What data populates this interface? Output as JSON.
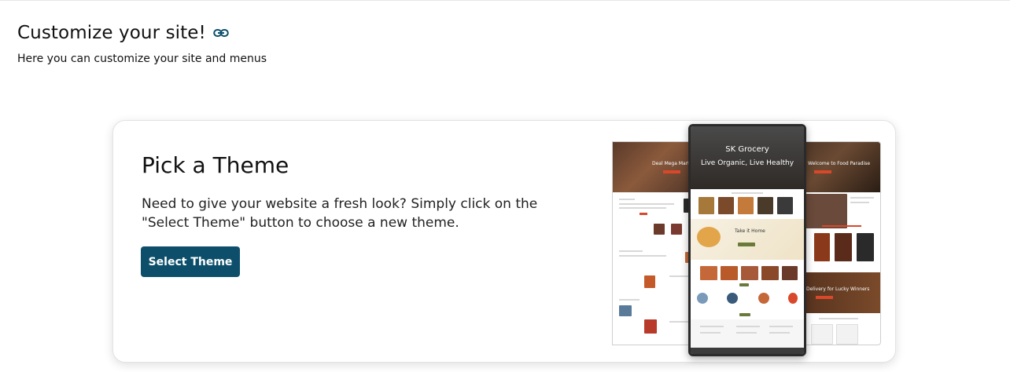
{
  "header": {
    "title": "Customize your site!",
    "subtitle": "Here you can customize your site and menus",
    "link_icon": "link-icon"
  },
  "theme_card": {
    "heading": "Pick a Theme",
    "description": "Need to give your website a fresh look? Simply click on the \"Select Theme\" button to choose a new theme.",
    "button_label": "Select Theme"
  },
  "preview": {
    "left_title": "Deal Mega Mart",
    "center_title": "SK Grocery",
    "center_tagline": "Live Organic, Live Healthy",
    "center_section": "Take it Home",
    "right_title": "Welcome to Food Paradise",
    "right_banner": "Delivery for Lucky Winners"
  },
  "colors": {
    "button": "#0d4f6b",
    "link_icon": "#0d4f6b",
    "accent": "#d9482b"
  }
}
